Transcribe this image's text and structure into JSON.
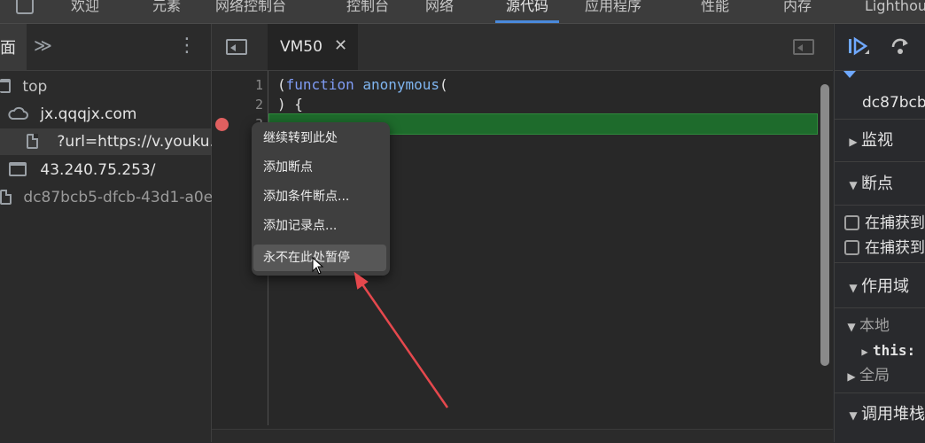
{
  "top_tabs": {
    "welcome": "欢迎",
    "elements": "元素",
    "network_console": "网络控制台",
    "console": "控制台",
    "network": "网络",
    "sources": "源代码",
    "application": "应用程序",
    "performance": "性能",
    "memory": "内存",
    "lighthouse": "Lighthou"
  },
  "navigator": {
    "page_tab_fragment": "面",
    "more_tabs": "≫",
    "menu": "⋮",
    "tree": {
      "top": "top",
      "domain": "jx.qqqjx.com",
      "file": "?url=https://v.youku.c",
      "ip_frame": "43.240.75.253/",
      "vm_script": "dc87bcb5-dfcb-43d1-a0ec"
    }
  },
  "editor": {
    "tab_title": "VM50",
    "tab_close": "✕",
    "line_numbers": [
      "1",
      "2",
      "3"
    ],
    "code": {
      "line1_paren": "(",
      "line1_kw": "function",
      "line1_name": "anonymous",
      "line1_open": "(",
      "line2": ") {"
    }
  },
  "context_menu": {
    "items": [
      "继续转到此处",
      "添加断点",
      "添加条件断点...",
      "添加记录点...",
      "永不在此处暂停"
    ]
  },
  "debugger": {
    "thread_name": "dc87bcb",
    "sections": {
      "watch": "监视",
      "breakpoints": "断点",
      "caught_exceptions": "在捕获到",
      "uncaught_exceptions": "在捕获到",
      "scope": "作用域",
      "local": "本地",
      "this": "this:",
      "global": "全局",
      "call_stack": "调用堆栈"
    }
  },
  "colors": {
    "accent_blue": "#4a89dc",
    "highlight_green": "#1e6b2c",
    "breakpoint_red": "#e06060",
    "arrow_red": "#e5484d",
    "keyword": "#7f9cf5",
    "function_name": "#7fb5f0"
  }
}
